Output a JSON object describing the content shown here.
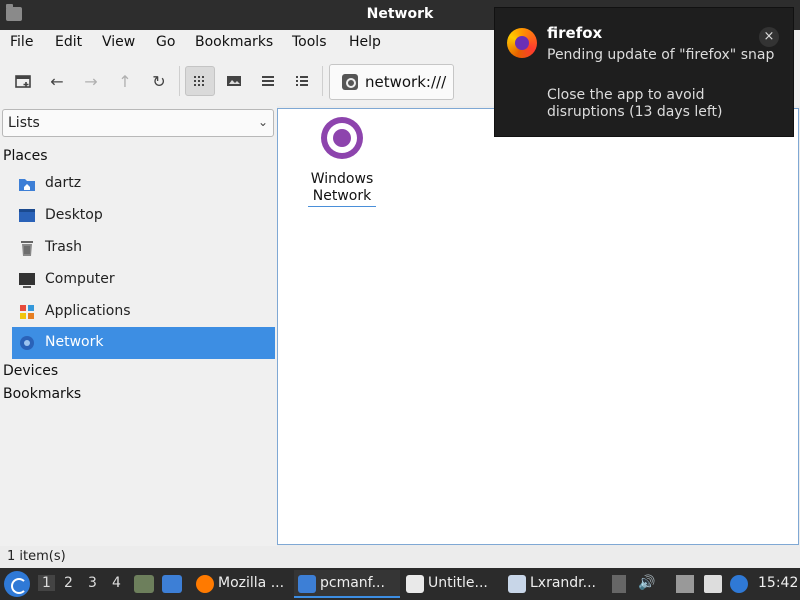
{
  "window": {
    "title": "Network"
  },
  "menu": [
    "File",
    "Edit",
    "View",
    "Go",
    "Bookmarks",
    "Tools",
    "Help"
  ],
  "toolbar": {
    "icons": [
      "new-tab-icon",
      "back-icon",
      "forward-icon",
      "up-icon",
      "reload-icon",
      "icon-view-icon",
      "thumbnail-view-icon",
      "compact-view-icon",
      "detailed-list-view-icon"
    ],
    "path": "network:///"
  },
  "sidepane": {
    "mode": "Lists",
    "places_header": "Places",
    "places": [
      {
        "label": "dartz",
        "icon": "home-folder-icon"
      },
      {
        "label": "Desktop",
        "icon": "desktop-icon"
      },
      {
        "label": "Trash",
        "icon": "trash-icon"
      },
      {
        "label": "Computer",
        "icon": "computer-icon"
      },
      {
        "label": "Applications",
        "icon": "applications-icon"
      },
      {
        "label": "Network",
        "icon": "network-icon",
        "selected": true
      }
    ],
    "devices_header": "Devices",
    "bookmarks_header": "Bookmarks"
  },
  "files": [
    {
      "label": "Windows Network",
      "icon": "windows-network-icon"
    }
  ],
  "status": {
    "text": "1 item(s)"
  },
  "notification": {
    "app": "firefox",
    "line1": "Pending update of \"firefox\" snap",
    "line2": "Close the app to avoid disruptions (13 days left)"
  },
  "taskbar": {
    "workspaces": [
      "1",
      "2",
      "3",
      "4"
    ],
    "current_workspace": "1",
    "tasks": [
      {
        "label": "Mozilla ...",
        "icon": "firefox-icon"
      },
      {
        "label": "pcmanf...",
        "icon": "file-manager-icon",
        "active": true
      },
      {
        "label": "Untitle...",
        "icon": "text-editor-icon"
      },
      {
        "label": "Lxrandr...",
        "icon": "display-settings-icon"
      }
    ],
    "clock": "15:42"
  },
  "colors": {
    "selection": "#3d8ee3",
    "titlebar": "#2d2d2d",
    "taskbar": "#2b2b2b",
    "notification_bg": "#1e1e1e",
    "network_purple": "#8d44ad"
  }
}
